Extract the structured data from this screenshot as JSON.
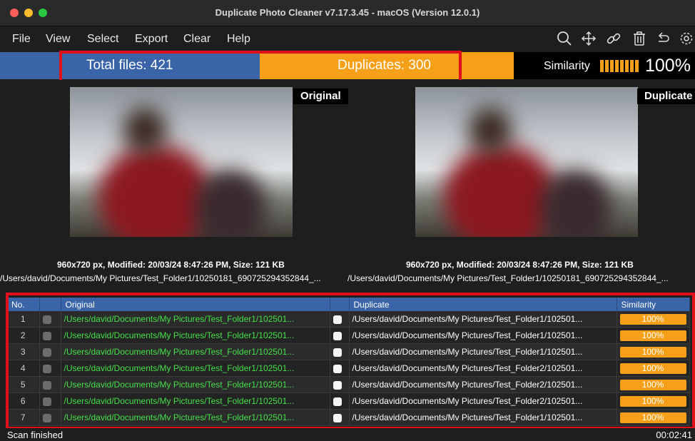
{
  "window": {
    "title": "Duplicate Photo Cleaner v7.17.3.45 - macOS (Version 12.0.1)"
  },
  "menu": [
    "File",
    "View",
    "Select",
    "Export",
    "Clear",
    "Help"
  ],
  "toolbar_icons": [
    "search-icon",
    "move-icon",
    "link-icon",
    "trash-icon",
    "undo-icon",
    "gear-icon"
  ],
  "stats": {
    "total": "Total files: 421",
    "duplicates": "Duplicates: 300",
    "similarity_label": "Similarity",
    "similarity_value": "100%"
  },
  "preview": {
    "original_badge": "Original",
    "duplicate_badge": "Duplicate",
    "original_meta": "960x720 px, Modified: 20/03/24 8:47:26 PM, Size: 121 KB",
    "duplicate_meta": "960x720 px, Modified: 20/03/24 8:47:26 PM, Size: 121 KB",
    "original_path": "/Users/david/Documents/My Pictures/Test_Folder1/10250181_690725294352844_...",
    "duplicate_path": "/Users/david/Documents/My Pictures/Test_Folder1/10250181_690725294352844_..."
  },
  "table": {
    "headers": [
      "No.",
      "",
      "Original",
      "",
      "Duplicate",
      "Similarity"
    ],
    "rows": [
      {
        "no": "1",
        "original": "/Users/david/Documents/My Pictures/Test_Folder1/102501...",
        "duplicate": "/Users/david/Documents/My Pictures/Test_Folder1/102501...",
        "similarity": "100%"
      },
      {
        "no": "2",
        "original": "/Users/david/Documents/My Pictures/Test_Folder1/102501...",
        "duplicate": "/Users/david/Documents/My Pictures/Test_Folder1/102501...",
        "similarity": "100%"
      },
      {
        "no": "3",
        "original": "/Users/david/Documents/My Pictures/Test_Folder1/102501...",
        "duplicate": "/Users/david/Documents/My Pictures/Test_Folder1/102501...",
        "similarity": "100%"
      },
      {
        "no": "4",
        "original": "/Users/david/Documents/My Pictures/Test_Folder1/102501...",
        "duplicate": "/Users/david/Documents/My Pictures/Test_Folder2/102501...",
        "similarity": "100%"
      },
      {
        "no": "5",
        "original": "/Users/david/Documents/My Pictures/Test_Folder1/102501...",
        "duplicate": "/Users/david/Documents/My Pictures/Test_Folder2/102501...",
        "similarity": "100%"
      },
      {
        "no": "6",
        "original": "/Users/david/Documents/My Pictures/Test_Folder1/102501...",
        "duplicate": "/Users/david/Documents/My Pictures/Test_Folder2/102501...",
        "similarity": "100%"
      },
      {
        "no": "7",
        "original": "/Users/david/Documents/Mv Pictures/Test_Folder1/102501...",
        "duplicate": "/Users/david/Documents/Mv Pictures/Test_Folder1/102501...",
        "similarity": "100%"
      }
    ]
  },
  "status": {
    "left": "Scan finished",
    "right": "00:02:41"
  },
  "colors": {
    "accent_blue": "#3a64a8",
    "accent_orange": "#f6a01a",
    "original_path_green": "#45e04a",
    "highlight_red": "#e0101a"
  }
}
